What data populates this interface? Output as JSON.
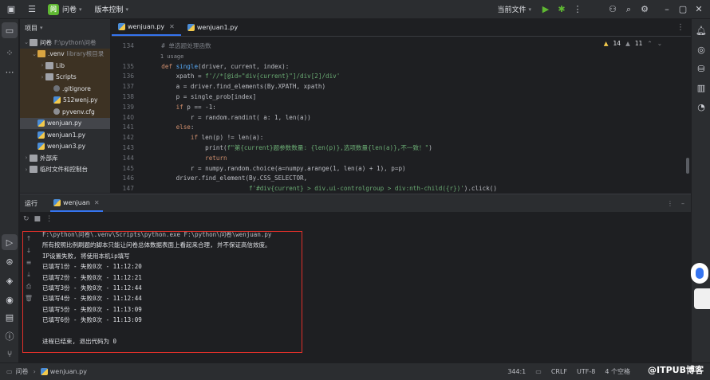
{
  "titlebar": {
    "project_badge": "问",
    "project_name": "问卷",
    "vcs_label": "版本控制",
    "run_config": "当前文件",
    "icons": [
      "hamburger-icon",
      "run-icon",
      "debug-icon",
      "more-icon",
      "add-user-icon",
      "search-icon",
      "settings-icon",
      "minimize-icon",
      "maximize-icon",
      "close-icon"
    ]
  },
  "project_panel": {
    "title": "项目",
    "tree": [
      {
        "label": "问卷",
        "hint": "F:\\python\\问卷",
        "indent": 0,
        "type": "folder",
        "open": true
      },
      {
        "label": ".venv",
        "hint": "library根目录",
        "indent": 1,
        "type": "folder-orange",
        "open": true
      },
      {
        "label": "Lib",
        "hint": "",
        "indent": 2,
        "type": "folder",
        "open": false
      },
      {
        "label": "Scripts",
        "hint": "",
        "indent": 2,
        "type": "folder",
        "open": false
      },
      {
        "label": ".gitignore",
        "hint": "",
        "indent": 3,
        "type": "git"
      },
      {
        "label": "512wenj.py",
        "hint": "",
        "indent": 3,
        "type": "py"
      },
      {
        "label": "pyvenv.cfg",
        "hint": "",
        "indent": 3,
        "type": "cfg"
      },
      {
        "label": "wenjuan.py",
        "hint": "",
        "indent": 1,
        "type": "py",
        "selected": true
      },
      {
        "label": "wenjuan1.py",
        "hint": "",
        "indent": 1,
        "type": "py"
      },
      {
        "label": "wenjuan3.py",
        "hint": "",
        "indent": 1,
        "type": "py"
      },
      {
        "label": "外部库",
        "hint": "",
        "indent": 0,
        "type": "lib",
        "open": false
      },
      {
        "label": "临时文件和控制台",
        "hint": "",
        "indent": 0,
        "type": "scratch",
        "open": false
      }
    ]
  },
  "editor": {
    "tabs": [
      {
        "label": "wenjuan.py",
        "active": true
      },
      {
        "label": "wenjuan1.py",
        "active": false
      }
    ],
    "inspections": {
      "warnings": "14",
      "weak": "11"
    },
    "line_numbers": [
      "134",
      "",
      "135",
      "136",
      "137",
      "138",
      "139",
      "140",
      "141",
      "142",
      "143",
      "144",
      "145",
      "146",
      "147"
    ],
    "lines": [
      "    # 单选题处理函数",
      "    1 usage",
      "    def single(driver, current, index):",
      "        xpath = f'//*[@id=\"div{current}\"]/div[2]/div'",
      "        a = driver.find_elements(By.XPATH, xpath)",
      "        p = single_prob[index]",
      "        if p == -1:",
      "            r = random.randint( a: 1, len(a))",
      "        else:",
      "            if len(p) != len(a):",
      "                print(f\"第{current}题参数数量: {len(p)},选项数量{len(a)},不一致！\")",
      "                return",
      "            r = numpy.random.choice(a=numpy.arange(1, len(a) + 1), p=p)",
      "        driver.find_element(By.CSS_SELECTOR,",
      "                            f'#div{current} > div.ui-controlgroup > div:nth-child({r})').click()"
    ]
  },
  "run_panel": {
    "title": "运行",
    "tab": "wenjuan",
    "output": [
      "F:\\python\\问卷\\.venv\\Scripts\\python.exe F:\\python\\问卷\\wenjuan.py",
      "所有按照比例刷题的脚本只能让问卷总体数据表面上看起来合理, 并不保证高信效度。",
      "IP设置失败, 将使用本机ip填写",
      "已填写1份 - 失败0次 - 11:12:20",
      "已填写2份 - 失败0次 - 11:12:21",
      "已填写3份 - 失败0次 - 11:12:44",
      "已填写4份 - 失败0次 - 11:12:44",
      "已填写5份 - 失败0次 - 11:13:09",
      "已填写6份 - 失败0次 - 11:13:09",
      "",
      "进程已结束, 退出代码为 0"
    ]
  },
  "statusbar": {
    "breadcrumb_root": "问卷",
    "breadcrumb_file": "wenjuan.py",
    "position": "344:1",
    "line_ending": "CRLF",
    "encoding": "UTF-8",
    "indent": "4 个空格",
    "watermark": "@ITPUB博客"
  }
}
